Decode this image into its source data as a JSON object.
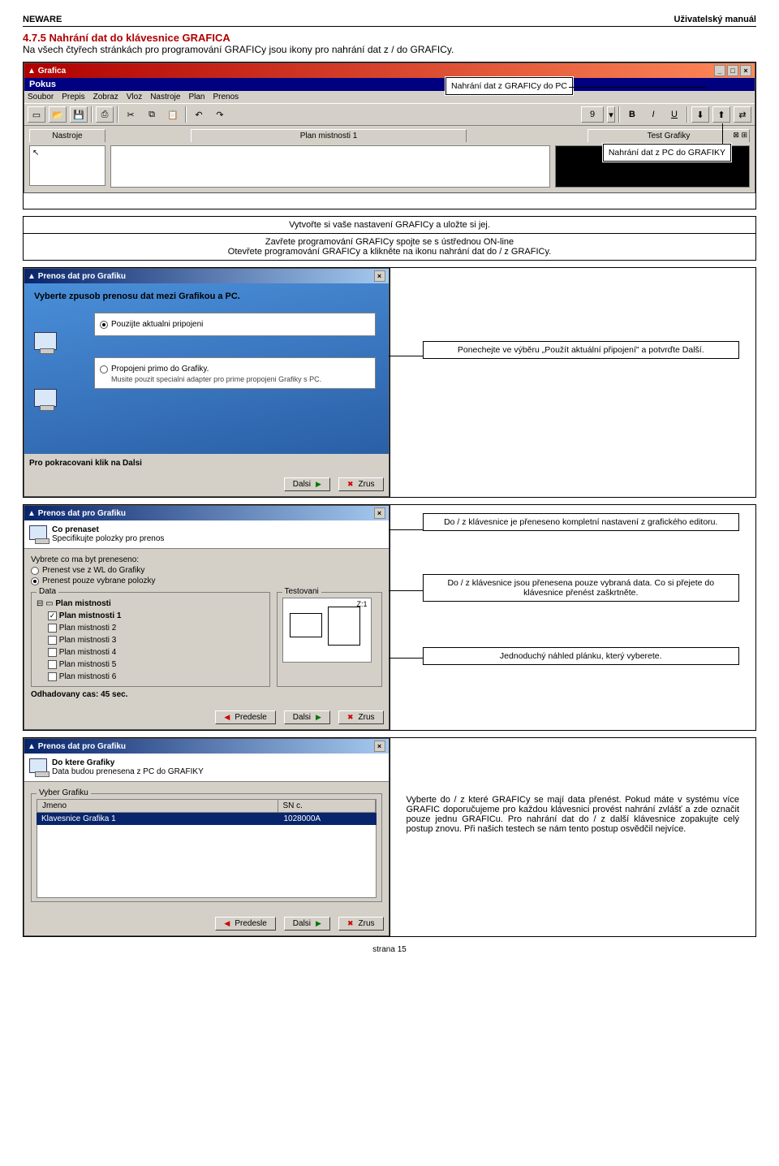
{
  "header": {
    "left": "NEWARE",
    "right": "Uživatelský manuál"
  },
  "section": {
    "title": "4.7.5 Nahrání dat do klávesnice GRAFICA",
    "text": "Na všech čtyřech stránkách pro programování GRAFICy jsou ikony pro nahrání dat z / do GRAFICy."
  },
  "callouts": {
    "c1": "Nahrání dat z GRAFICy do PC",
    "c2": "Nahrání dat z PC do GRAFIKY",
    "c3": "Ponechejte ve výběru „Použít aktuální připojení\" a potvrďte Další.",
    "c4": "Do / z klávesnice je přeneseno kompletní nastavení z grafického editoru.",
    "c5": "Do / z klávesnice jsou přenesena pouze vybraná data. Co si přejete do klávesnice přenést zaškrtněte.",
    "c6": "Jednoduchý náhled plánku, který vyberete.",
    "c7": "Vyberte do / z které GRAFICy se mají data přenést. Pokud máte v systému více GRAFIC doporučujeme pro každou klávesnici provést nahrání zvlášť a zde označit pouze jednu GRAFICu. Pro nahrání dat do / z další klávesnice zopakujte celý postup znovu. Při našich testech se nám tento postup osvědčil nejvíce."
  },
  "steps": {
    "s1": "Vytvořte si vaše nastavení GRAFICy a uložte si jej.",
    "s2": "Zavřete programování GRAFICy spojte se s ústřednou ON-line",
    "s3": "Otevřete programování GRAFICy a klikněte na ikonu nahrání dat do / z GRAFICy."
  },
  "grafica": {
    "title": "Grafica",
    "docname": "Pokus",
    "menu": [
      "Soubor",
      "Prepis",
      "Zobraz",
      "Vloz",
      "Nastroje",
      "Plan",
      "Prenos"
    ],
    "tabs": {
      "left": "Nastroje",
      "mid": "Plan mistnosti 1",
      "right": "Test Grafiky"
    },
    "fontsize": "9"
  },
  "wiz1": {
    "title": "Prenos dat pro Grafiku",
    "h1": "Vyberte zpusob prenosu dat mezi Grafikou a PC.",
    "opt1": "Pouzijte aktualni pripojeni",
    "opt2": "Propojeni primo do Grafiky.",
    "opt2b": "Musite pouzit specialni adapter pro prime propojeni Grafiky s PC.",
    "cont": "Pro pokracovani klik na Dalsi",
    "btn_next": "Dalsi",
    "btn_cancel": "Zrus"
  },
  "wiz2": {
    "title": "Prenos dat pro Grafiku",
    "h1": "Co prenaset",
    "h2": "Specifikujte polozky pro prenos",
    "q": "Vybrete co ma byt preneseno:",
    "r1": "Prenest vse z WL do Grafiky",
    "r2": "Prenest pouze vybrane polozky",
    "grp_data": "Data",
    "grp_test": "Testovani",
    "tree_root": "Plan mistnosti",
    "tree_items": [
      "Plan mistnosti 1",
      "Plan mistnosti 2",
      "Plan mistnosti 3",
      "Plan mistnosti 4",
      "Plan mistnosti 5",
      "Plan mistnosti 6"
    ],
    "eta": "Odhadovany cas:  45 sec.",
    "zoom": "Z:1",
    "btn_prev": "Predesle",
    "btn_next": "Dalsi",
    "btn_cancel": "Zrus"
  },
  "wiz3": {
    "title": "Prenos dat pro Grafiku",
    "h1": "Do ktere Grafiky",
    "h2": "Data budou prenesena z PC do GRAFIKY",
    "grp": "Vyber Grafiku",
    "col1": "Jmeno",
    "col2": "SN c.",
    "row_name": "Klavesnice Grafika 1",
    "row_sn": "1028000A",
    "btn_prev": "Predesle",
    "btn_next": "Dalsi",
    "btn_cancel": "Zrus"
  },
  "footer": "strana 15"
}
